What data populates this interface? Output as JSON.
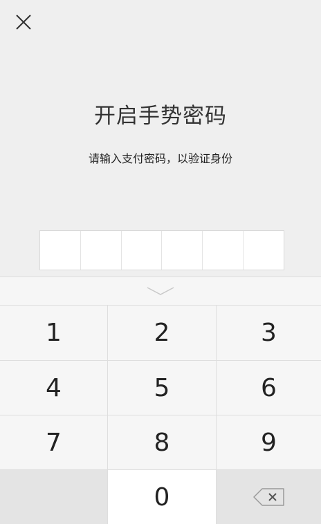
{
  "header": {
    "close_icon": "close-icon"
  },
  "main": {
    "title": "开启手势密码",
    "subtitle": "请输入支付密码，以验证身份",
    "pin_length": 6
  },
  "keyboard": {
    "collapse_icon": "chevron-down-icon",
    "keys": {
      "k1": "1",
      "k2": "2",
      "k3": "3",
      "k4": "4",
      "k5": "5",
      "k6": "6",
      "k7": "7",
      "k8": "8",
      "k9": "9",
      "k0": "0"
    },
    "backspace_icon": "backspace-icon"
  },
  "colors": {
    "background": "#efefef",
    "keyboard_bg": "#f6f6f6",
    "key_gray": "#e4e4e4",
    "text": "#222222"
  }
}
